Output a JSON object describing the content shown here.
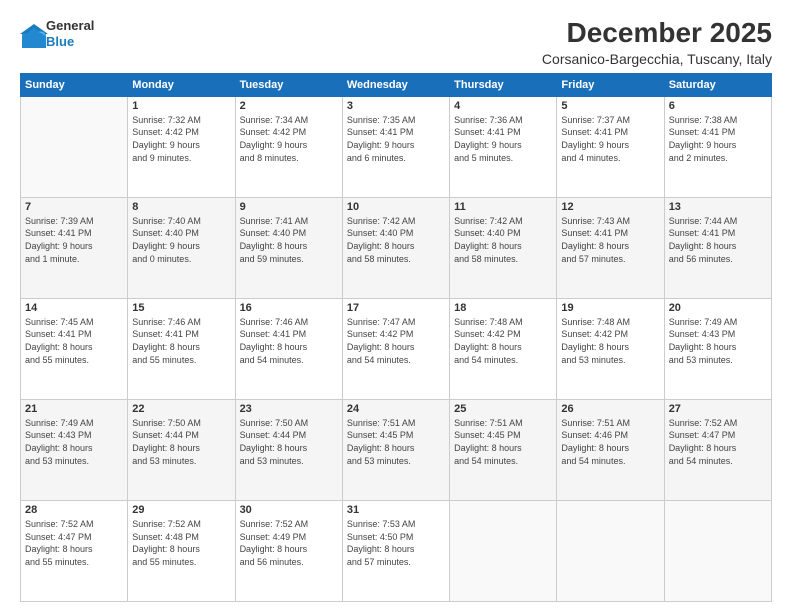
{
  "logo": {
    "line1": "General",
    "line2": "Blue"
  },
  "title": "December 2025",
  "location": "Corsanico-Bargecchia, Tuscany, Italy",
  "headers": [
    "Sunday",
    "Monday",
    "Tuesday",
    "Wednesday",
    "Thursday",
    "Friday",
    "Saturday"
  ],
  "weeks": [
    [
      {
        "day": "",
        "info": ""
      },
      {
        "day": "1",
        "info": "Sunrise: 7:32 AM\nSunset: 4:42 PM\nDaylight: 9 hours\nand 9 minutes."
      },
      {
        "day": "2",
        "info": "Sunrise: 7:34 AM\nSunset: 4:42 PM\nDaylight: 9 hours\nand 8 minutes."
      },
      {
        "day": "3",
        "info": "Sunrise: 7:35 AM\nSunset: 4:41 PM\nDaylight: 9 hours\nand 6 minutes."
      },
      {
        "day": "4",
        "info": "Sunrise: 7:36 AM\nSunset: 4:41 PM\nDaylight: 9 hours\nand 5 minutes."
      },
      {
        "day": "5",
        "info": "Sunrise: 7:37 AM\nSunset: 4:41 PM\nDaylight: 9 hours\nand 4 minutes."
      },
      {
        "day": "6",
        "info": "Sunrise: 7:38 AM\nSunset: 4:41 PM\nDaylight: 9 hours\nand 2 minutes."
      }
    ],
    [
      {
        "day": "7",
        "info": "Sunrise: 7:39 AM\nSunset: 4:41 PM\nDaylight: 9 hours\nand 1 minute."
      },
      {
        "day": "8",
        "info": "Sunrise: 7:40 AM\nSunset: 4:40 PM\nDaylight: 9 hours\nand 0 minutes."
      },
      {
        "day": "9",
        "info": "Sunrise: 7:41 AM\nSunset: 4:40 PM\nDaylight: 8 hours\nand 59 minutes."
      },
      {
        "day": "10",
        "info": "Sunrise: 7:42 AM\nSunset: 4:40 PM\nDaylight: 8 hours\nand 58 minutes."
      },
      {
        "day": "11",
        "info": "Sunrise: 7:42 AM\nSunset: 4:40 PM\nDaylight: 8 hours\nand 58 minutes."
      },
      {
        "day": "12",
        "info": "Sunrise: 7:43 AM\nSunset: 4:41 PM\nDaylight: 8 hours\nand 57 minutes."
      },
      {
        "day": "13",
        "info": "Sunrise: 7:44 AM\nSunset: 4:41 PM\nDaylight: 8 hours\nand 56 minutes."
      }
    ],
    [
      {
        "day": "14",
        "info": "Sunrise: 7:45 AM\nSunset: 4:41 PM\nDaylight: 8 hours\nand 55 minutes."
      },
      {
        "day": "15",
        "info": "Sunrise: 7:46 AM\nSunset: 4:41 PM\nDaylight: 8 hours\nand 55 minutes."
      },
      {
        "day": "16",
        "info": "Sunrise: 7:46 AM\nSunset: 4:41 PM\nDaylight: 8 hours\nand 54 minutes."
      },
      {
        "day": "17",
        "info": "Sunrise: 7:47 AM\nSunset: 4:42 PM\nDaylight: 8 hours\nand 54 minutes."
      },
      {
        "day": "18",
        "info": "Sunrise: 7:48 AM\nSunset: 4:42 PM\nDaylight: 8 hours\nand 54 minutes."
      },
      {
        "day": "19",
        "info": "Sunrise: 7:48 AM\nSunset: 4:42 PM\nDaylight: 8 hours\nand 53 minutes."
      },
      {
        "day": "20",
        "info": "Sunrise: 7:49 AM\nSunset: 4:43 PM\nDaylight: 8 hours\nand 53 minutes."
      }
    ],
    [
      {
        "day": "21",
        "info": "Sunrise: 7:49 AM\nSunset: 4:43 PM\nDaylight: 8 hours\nand 53 minutes."
      },
      {
        "day": "22",
        "info": "Sunrise: 7:50 AM\nSunset: 4:44 PM\nDaylight: 8 hours\nand 53 minutes."
      },
      {
        "day": "23",
        "info": "Sunrise: 7:50 AM\nSunset: 4:44 PM\nDaylight: 8 hours\nand 53 minutes."
      },
      {
        "day": "24",
        "info": "Sunrise: 7:51 AM\nSunset: 4:45 PM\nDaylight: 8 hours\nand 53 minutes."
      },
      {
        "day": "25",
        "info": "Sunrise: 7:51 AM\nSunset: 4:45 PM\nDaylight: 8 hours\nand 54 minutes."
      },
      {
        "day": "26",
        "info": "Sunrise: 7:51 AM\nSunset: 4:46 PM\nDaylight: 8 hours\nand 54 minutes."
      },
      {
        "day": "27",
        "info": "Sunrise: 7:52 AM\nSunset: 4:47 PM\nDaylight: 8 hours\nand 54 minutes."
      }
    ],
    [
      {
        "day": "28",
        "info": "Sunrise: 7:52 AM\nSunset: 4:47 PM\nDaylight: 8 hours\nand 55 minutes."
      },
      {
        "day": "29",
        "info": "Sunrise: 7:52 AM\nSunset: 4:48 PM\nDaylight: 8 hours\nand 55 minutes."
      },
      {
        "day": "30",
        "info": "Sunrise: 7:52 AM\nSunset: 4:49 PM\nDaylight: 8 hours\nand 56 minutes."
      },
      {
        "day": "31",
        "info": "Sunrise: 7:53 AM\nSunset: 4:50 PM\nDaylight: 8 hours\nand 57 minutes."
      },
      {
        "day": "",
        "info": ""
      },
      {
        "day": "",
        "info": ""
      },
      {
        "day": "",
        "info": ""
      }
    ]
  ]
}
